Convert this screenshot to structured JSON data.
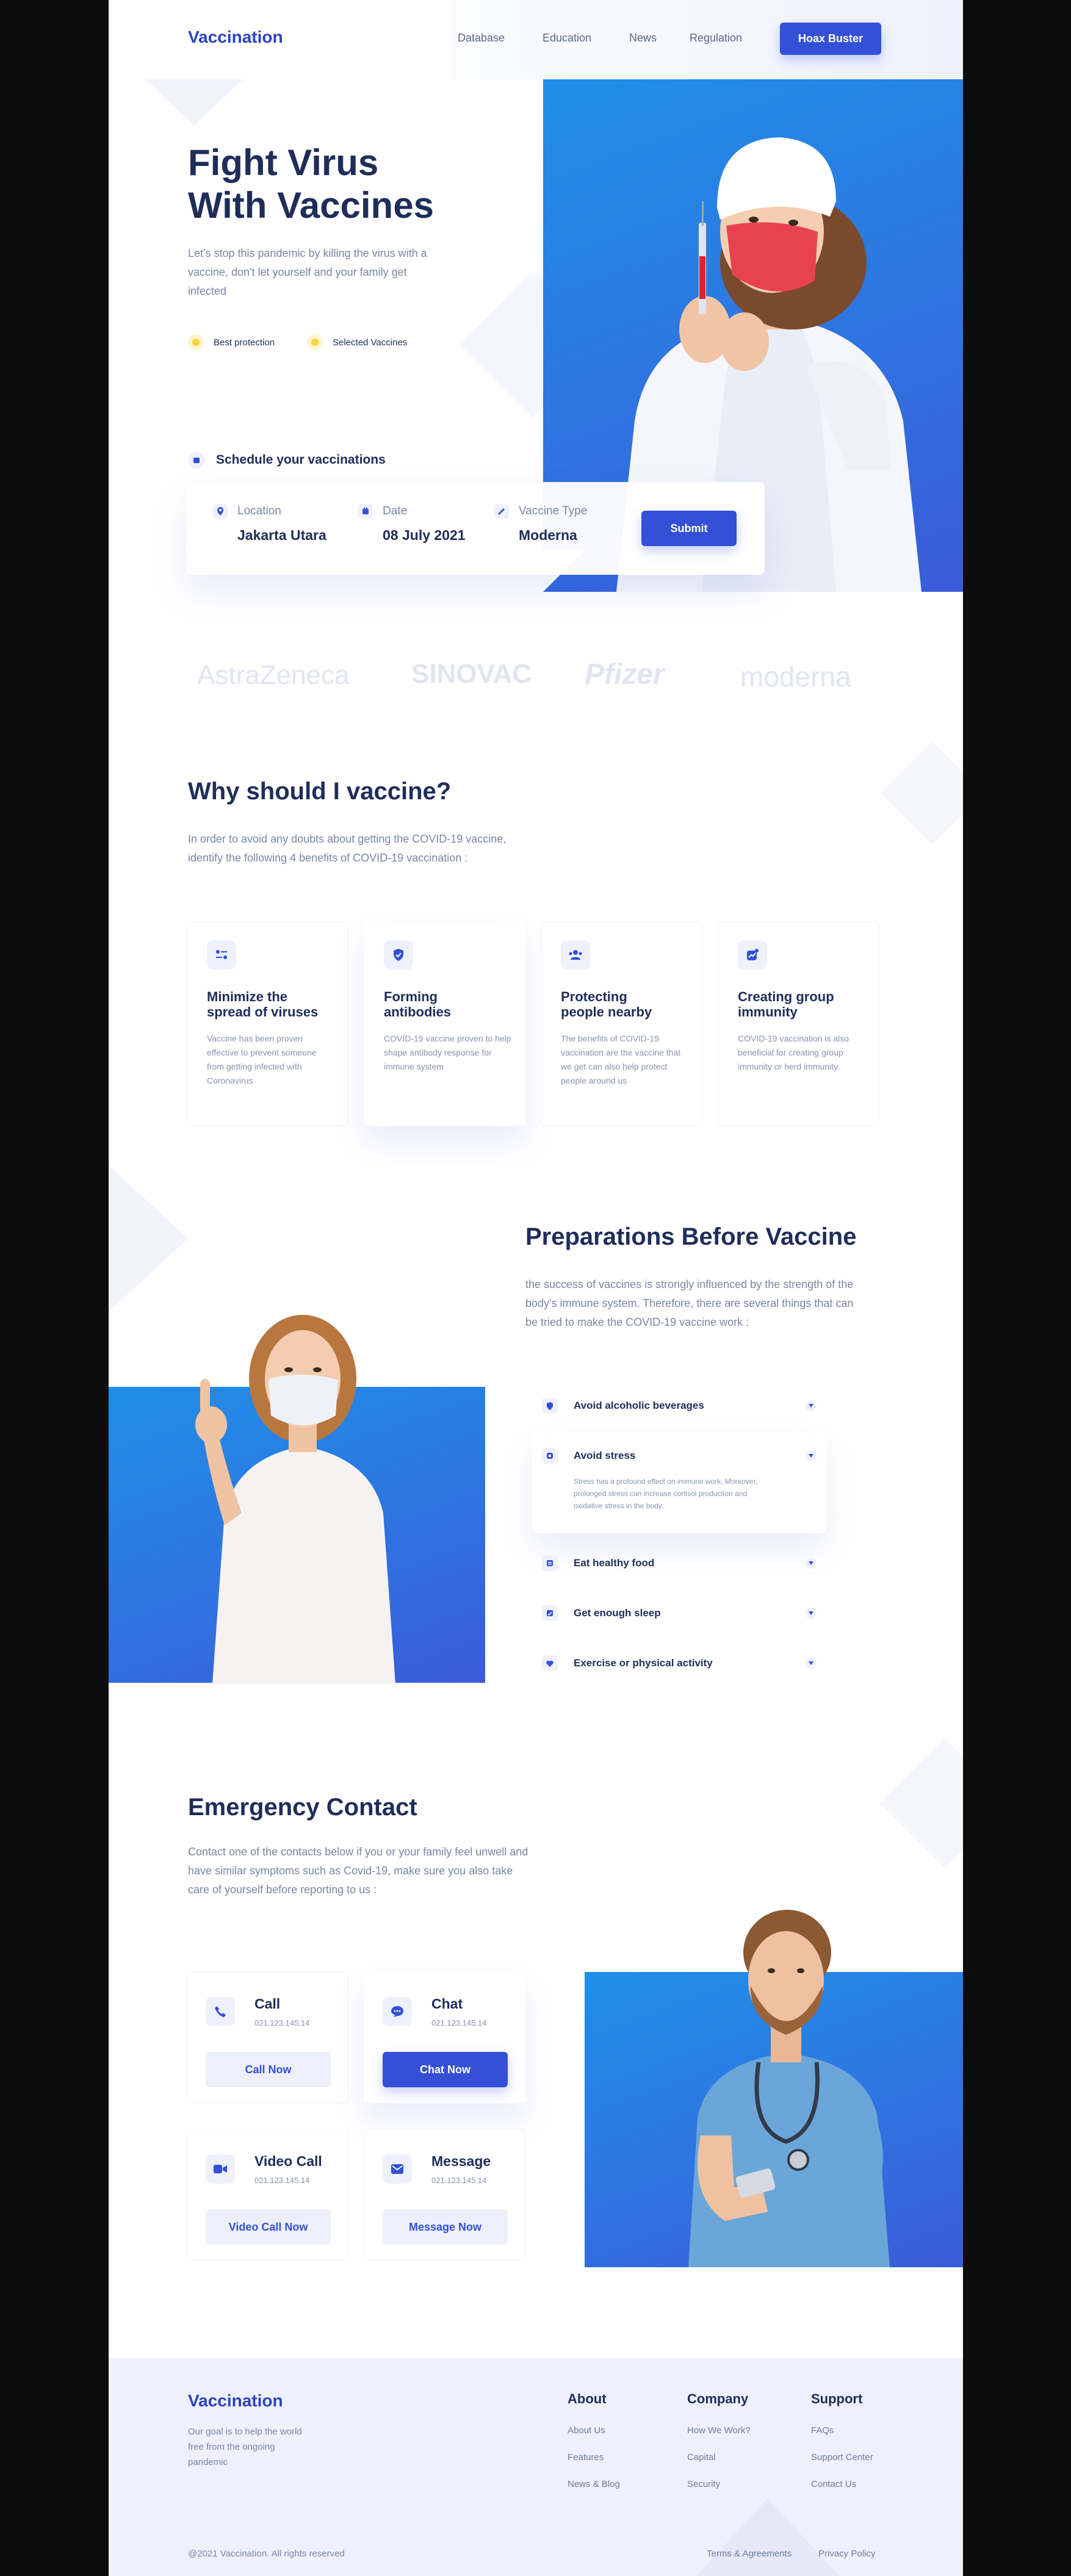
{
  "header": {
    "brand": "Vaccination",
    "nav": [
      "Database",
      "Education",
      "News",
      "Regulation"
    ],
    "cta": "Hoax Buster"
  },
  "hero": {
    "title_line1": "Fight Virus",
    "title_line2": "With Vaccines",
    "description": "Let's stop this pandemic by killing the virus with a vaccine, don't let yourself and your family get infected",
    "badges": [
      "Best protection",
      "Selected Vaccines"
    ],
    "schedule_label": "Schedule your vaccinations",
    "form": {
      "location_label": "Location",
      "location_value": "Jakarta Utara",
      "date_label": "Date",
      "date_value": "08 July 2021",
      "vaccine_label": "Vaccine Type",
      "vaccine_value": "Moderna",
      "submit": "Submit"
    }
  },
  "brands": [
    "AstraZeneca",
    "SINOVAC",
    "Pfizer",
    "moderna"
  ],
  "why": {
    "title": "Why should I vaccine?",
    "description": "In order to avoid any doubts about getting the COVID-19 vaccine, identify the following 4 benefits of COVID-19 vaccination :",
    "cards": [
      {
        "title1": "Minimize the",
        "title2": "spread of viruses",
        "text": "Vaccine has been proven effective to prevent someone from getting infected with Coronavirus"
      },
      {
        "title1": "Forming",
        "title2": "antibodies",
        "text": "COVID-19 vaccine proven to help shape antibody response for immune system"
      },
      {
        "title1": "Protecting",
        "title2": "people nearby",
        "text": "The benefits of COVID-19 vaccination are the vaccine that we get can also help protect people around us"
      },
      {
        "title1": "Creating group",
        "title2": "immunity",
        "text": "COVID-19 vaccination is also beneficial for creating group immunity or herd immunity."
      }
    ]
  },
  "prep": {
    "title": "Preparations Before Vaccine",
    "description": "the success of vaccines is strongly influenced by the strength of the body's immune system. Therefore, there are several things that can be tried to make the COVID-19 vaccine work :",
    "items": [
      {
        "label": "Avoid alcoholic beverages"
      },
      {
        "label": "Avoid stress",
        "detail": "Stress has a profound effect on immune work. Moreover, prolonged stress can increase cortisol production and oxidative stress in the body."
      },
      {
        "label": "Eat healthy food"
      },
      {
        "label": "Get enough sleep"
      },
      {
        "label": "Exercise or physical activity"
      }
    ]
  },
  "emergency": {
    "title": "Emergency Contact",
    "description": "Contact one of the contacts below if you or your family feel unwell and have similar symptoms such as Covid-19, make sure you also take care of yourself before reporting to us :",
    "contacts": [
      {
        "title": "Call",
        "number": "021.123.145.14",
        "button": "Call Now"
      },
      {
        "title": "Chat",
        "number": "021.123.145.14",
        "button": "Chat Now"
      },
      {
        "title": "Video Call",
        "number": "021.123.145.14",
        "button": "Video Call Now"
      },
      {
        "title": "Message",
        "number": "021.123.145.14",
        "button": "Message Now"
      }
    ]
  },
  "footer": {
    "brand": "Vaccination",
    "tagline": "Our goal is to help the world free from the ongoing pandemic",
    "columns": [
      {
        "title": "About",
        "links": [
          "About Us",
          "Features",
          "News & Blog"
        ]
      },
      {
        "title": "Company",
        "links": [
          "How We Work?",
          "Capital",
          "Security"
        ]
      },
      {
        "title": "Support",
        "links": [
          "FAQs",
          "Support Center",
          "Contact Us"
        ]
      }
    ],
    "copyright": "@2021 Vaccination. All rights reserved",
    "terms": "Terms & Agreements",
    "privacy": "Privacy Policy"
  },
  "colors": {
    "primary": "#3350d6",
    "navy": "#1f2d5a",
    "muted": "#7b85a3",
    "hero_blue": "#1e88e5",
    "badge_yellow": "#ffd43b",
    "footer_bg": "#eef1fb"
  }
}
